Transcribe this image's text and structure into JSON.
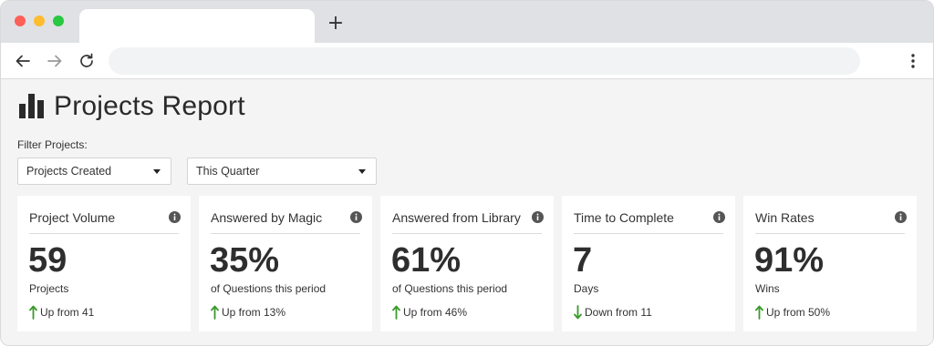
{
  "browser": {
    "new_tab_glyph": "+",
    "icons": [
      "back-arrow-icon",
      "forward-arrow-icon",
      "reload-icon",
      "more-vertical-icon"
    ]
  },
  "page": {
    "title": "Projects Report",
    "title_icon": "bar-chart-icon",
    "filter_label": "Filter Projects:",
    "filters": [
      {
        "selected": "Projects Created"
      },
      {
        "selected": "This Quarter"
      }
    ]
  },
  "colors": {
    "trend_up": "#3a9a2a",
    "trend_down": "#3a9a2a",
    "card_bg": "#ffffff",
    "page_bg": "#f4f4f4"
  },
  "cards": [
    {
      "title": "Project Volume",
      "value": "59",
      "unit": "Projects",
      "trend_dir": "up",
      "trend": "Up from 41"
    },
    {
      "title": "Answered by Magic",
      "value": "35%",
      "unit": "of Questions this period",
      "trend_dir": "up",
      "trend": "Up from 13%"
    },
    {
      "title": "Answered from Library",
      "value": "61%",
      "unit": "of Questions this period",
      "trend_dir": "up",
      "trend": "Up from 46%"
    },
    {
      "title": "Time to Complete",
      "value": "7",
      "unit": "Days",
      "trend_dir": "down",
      "trend": "Down from 11"
    },
    {
      "title": "Win Rates",
      "value": "91%",
      "unit": "Wins",
      "trend_dir": "up",
      "trend": "Up from 50%"
    }
  ]
}
